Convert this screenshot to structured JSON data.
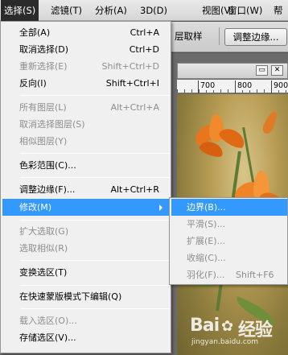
{
  "menubar": {
    "items": [
      {
        "label": "选择(S)"
      },
      {
        "label": "滤镜(T)"
      },
      {
        "label": "分析(A)"
      },
      {
        "label": "3D(D)"
      },
      {
        "label": "视图(V)"
      },
      {
        "label": "窗口(W)"
      },
      {
        "label": "帮"
      }
    ],
    "window_buttons": [
      "_",
      "▫"
    ]
  },
  "options_bar": {
    "sample_text": "层取样",
    "refine_edge_label": "调整边缘..."
  },
  "ruler": {
    "labels": [
      "700",
      "800",
      "900"
    ]
  },
  "doc_controls": [
    "▭",
    "✕"
  ],
  "select_menu": {
    "items": [
      {
        "label": "全部(A)",
        "shortcut": "Ctrl+A"
      },
      {
        "label": "取消选择(D)",
        "shortcut": "Ctrl+D"
      },
      {
        "label": "重新选择(E)",
        "shortcut": "Shift+Ctrl+D"
      },
      {
        "label": "反向(I)",
        "shortcut": "Shift+Ctrl+I"
      },
      {
        "label": "所有图层(L)",
        "shortcut": "Alt+Ctrl+A"
      },
      {
        "label": "取消选择图层(S)",
        "shortcut": ""
      },
      {
        "label": "相似图层(Y)",
        "shortcut": ""
      },
      {
        "label": "色彩范围(C)...",
        "shortcut": ""
      },
      {
        "label": "调整边缘(F)...",
        "shortcut": "Alt+Ctrl+R"
      },
      {
        "label": "修改(M)",
        "shortcut": ""
      },
      {
        "label": "扩大选取(G)",
        "shortcut": ""
      },
      {
        "label": "选取相似(R)",
        "shortcut": ""
      },
      {
        "label": "变换选区(T)",
        "shortcut": ""
      },
      {
        "label": "在快速蒙版模式下编辑(Q)",
        "shortcut": ""
      },
      {
        "label": "载入选区(O)...",
        "shortcut": ""
      },
      {
        "label": "存储选区(V)...",
        "shortcut": ""
      }
    ]
  },
  "modify_submenu": {
    "items": [
      {
        "label": "边界(B)...",
        "shortcut": ""
      },
      {
        "label": "平滑(S)...",
        "shortcut": ""
      },
      {
        "label": "扩展(E)...",
        "shortcut": ""
      },
      {
        "label": "收缩(C)...",
        "shortcut": ""
      },
      {
        "label": "羽化(F)...",
        "shortcut": "Shift+F6"
      }
    ]
  },
  "watermark": {
    "logo": "Bai",
    "logo_tail": "经验",
    "url": "jingyan.baidu.com"
  },
  "colors": {
    "highlight": "#3399ff",
    "menu_bg": "#f0f0f0",
    "disabled_text": "#8d8d8d",
    "active_menubar": "#2b2b2b"
  }
}
